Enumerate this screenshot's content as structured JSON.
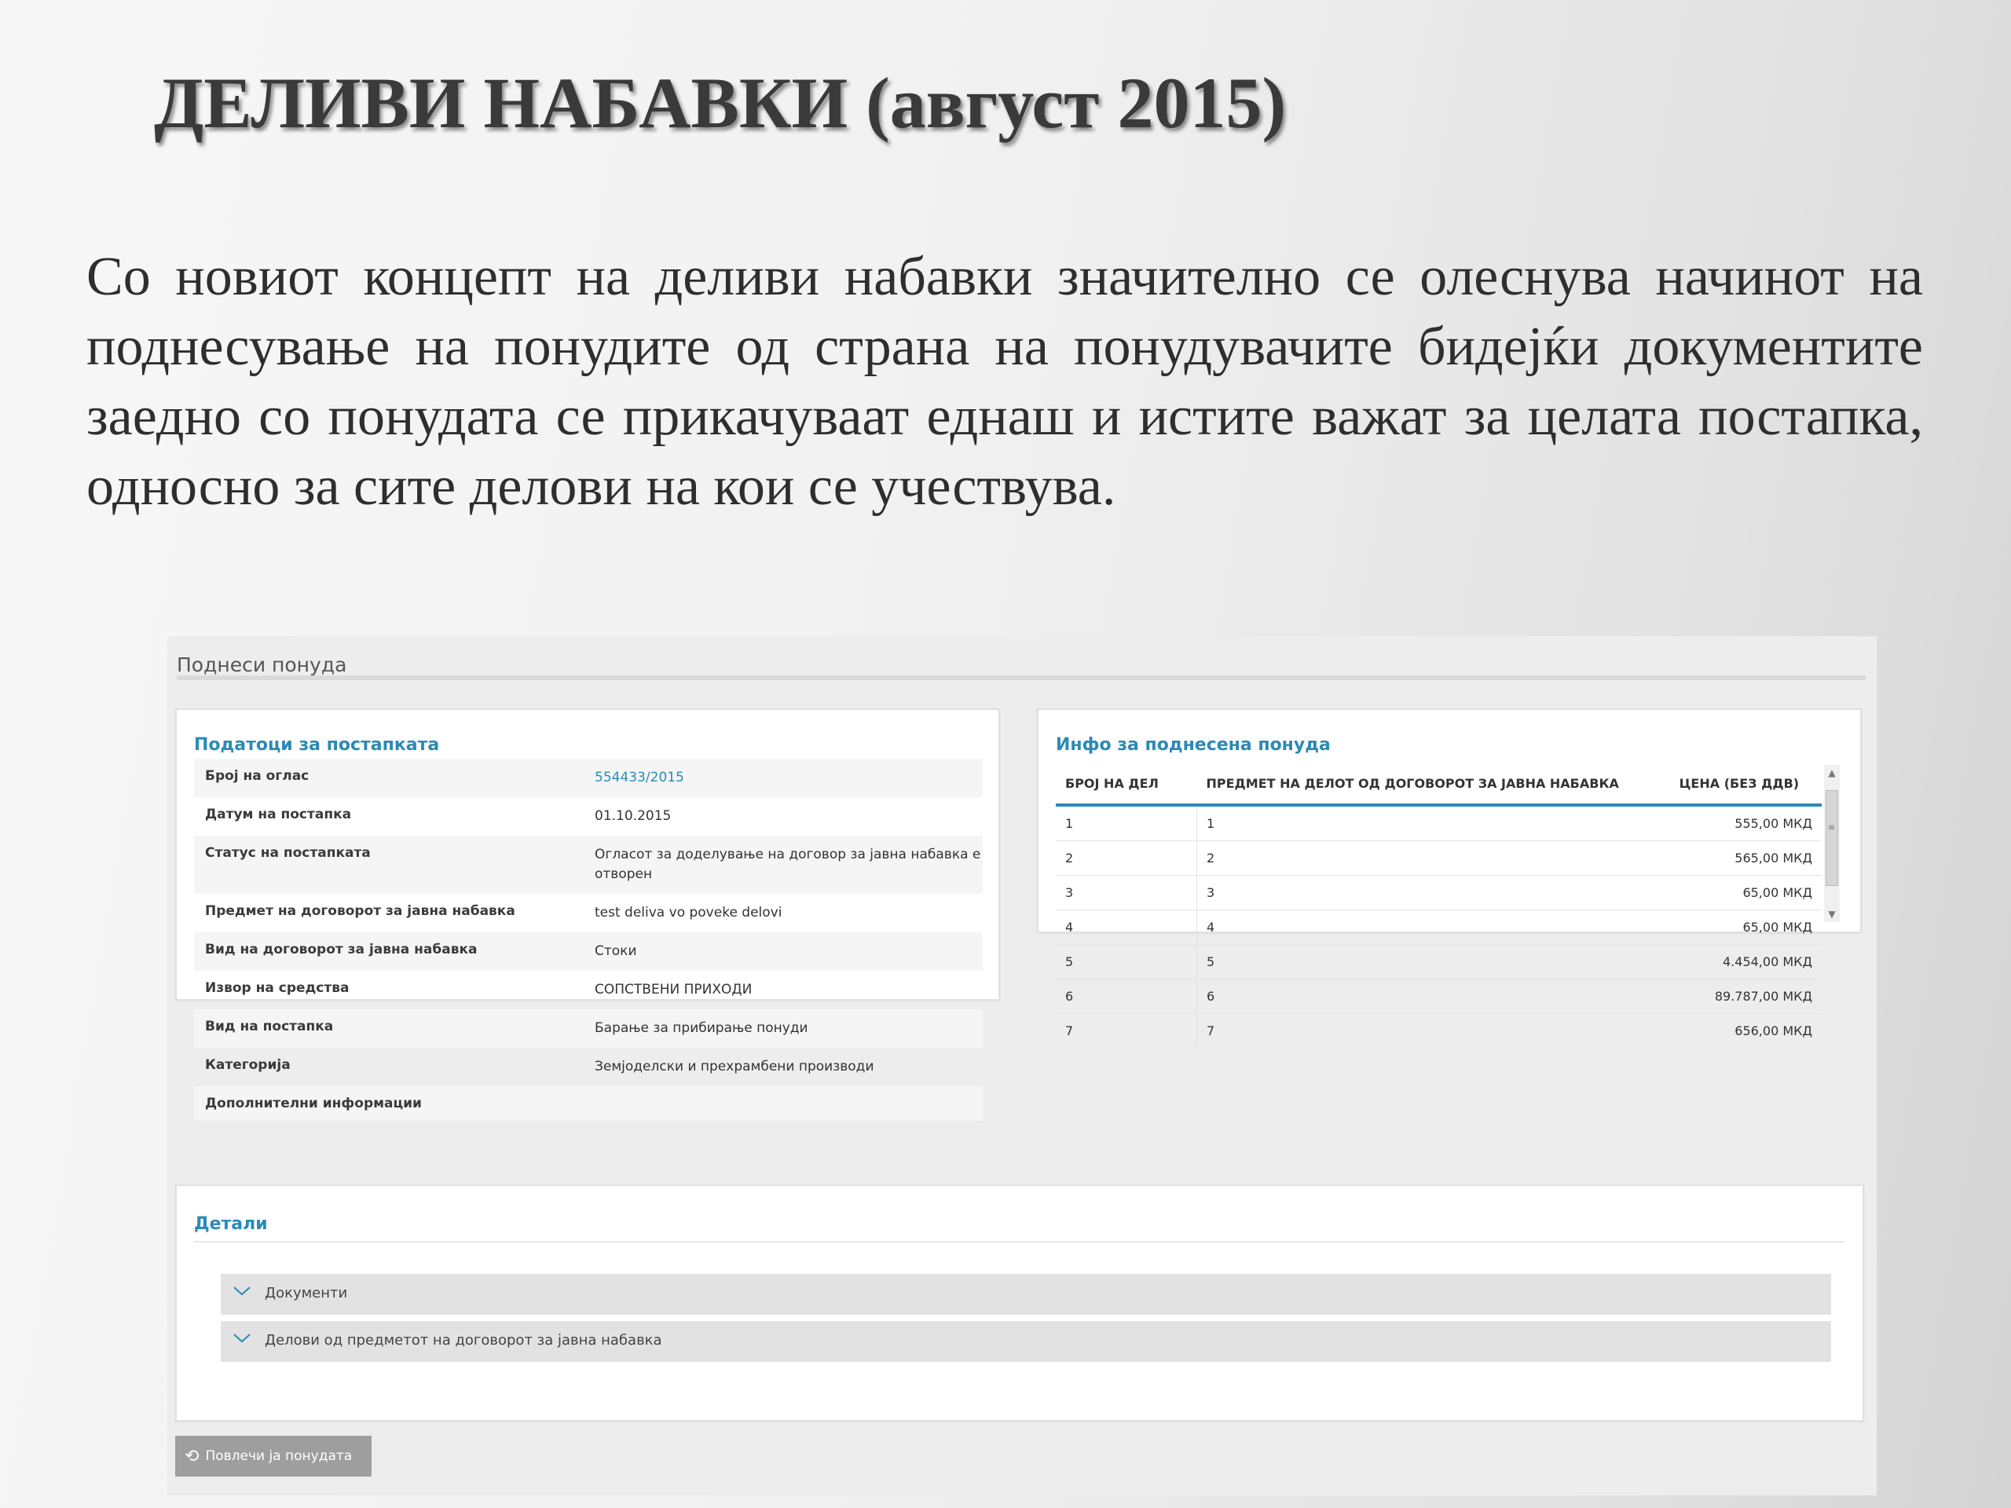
{
  "slide": {
    "title": "ДЕЛИВИ НАБАВКИ (август 2015)",
    "paragraph": "Со новиот концепт на деливи набавки значително се олеснува начинот на поднесување на понудите од страна на понудувачите бидејќи документите заедно со понудата се прикачуваат еднаш и истите важат за целата постапка, односно за сите делови на кои се учествува."
  },
  "screenshot": {
    "header": "Поднеси понуда",
    "procedure_panel": {
      "title": "Податоци за постапката",
      "rows": [
        {
          "label": "Број на оглас",
          "value": "554433/2015"
        },
        {
          "label": "Датум на постапка",
          "value": "01.10.2015"
        },
        {
          "label": "Статус на постапката",
          "value": "Огласот за доделување на договор за јавна набавка е отворен"
        },
        {
          "label": "Предмет на договорот за јавна набавка",
          "value": "test deliva vo poveke delovi"
        },
        {
          "label": "Вид на договорот за јавна набавка",
          "value": "Стоки"
        },
        {
          "label": "Извор на средства",
          "value": "СОПСТВЕНИ ПРИХОДИ"
        },
        {
          "label": "Вид на постапка",
          "value": "Барање за прибирање понуди"
        },
        {
          "label": "Категорија",
          "value": "Земјоделски и прехрамбени производи"
        },
        {
          "label": "Дополнителни информации",
          "value": ""
        }
      ]
    },
    "bid_panel": {
      "title": "Инфо за поднесена понуда",
      "columns": [
        "БРОЈ НА ДЕЛ",
        "ПРЕДМЕТ НА ДЕЛОТ ОД ДОГОВОРОТ ЗА ЈАВНА НАБАВКА",
        "ЦЕНА (БЕЗ ДДВ)"
      ],
      "rows": [
        [
          "1",
          "1",
          "555,00 МКД"
        ],
        [
          "2",
          "2",
          "565,00 МКД"
        ],
        [
          "3",
          "3",
          "65,00 МКД"
        ],
        [
          "4",
          "4",
          "65,00 МКД"
        ],
        [
          "5",
          "5",
          "4.454,00 МКД"
        ],
        [
          "6",
          "6",
          "89.787,00 МКД"
        ],
        [
          "7",
          "7",
          "656,00 МКД"
        ]
      ]
    },
    "details_panel": {
      "title": "Детали",
      "accordions": [
        "Документи",
        "Делови од предметот на договорот за јавна набавка"
      ]
    },
    "withdraw_button": "Повлечи ја понудата",
    "icons": {
      "chevron": "chevron-down-icon",
      "withdraw": "undo-icon",
      "accent_color": "#2b8ab6"
    }
  }
}
